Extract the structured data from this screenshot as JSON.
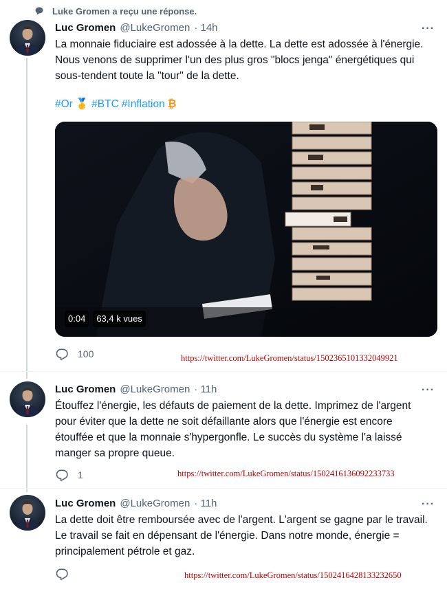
{
  "context": {
    "label": "Luke Gromen a reçu une réponse."
  },
  "tweets": [
    {
      "name": "Luc Gromen",
      "handle": "@LukeGromen",
      "time": "· 14h",
      "text": "La monnaie fiduciaire est adossée à la dette. La dette est adossée à l'énergie. Nous venons de supprimer l'un des plus gros \"blocs jenga\" énergétiques qui sous-tendent toute la \"tour\" de la dette.",
      "hashtags": [
        "#Or",
        "🥇",
        "#BTC",
        "#Inflation",
        "₿"
      ],
      "video": {
        "time": "0:04",
        "views": "63,4 k vues"
      },
      "replies": "100",
      "url": "https://twitter.com/LukeGromen/status/1502365101332049921"
    },
    {
      "name": "Luc Gromen",
      "handle": "@LukeGromen",
      "time": "· 11h",
      "text": "Étouffez l'énergie, les défauts de paiement de la dette. Imprimez de l'argent pour éviter que la dette ne soit défaillante alors que l'énergie est encore étouffée et que la monnaie s'hypergonfle. Le succès du système l'a laissé manger sa propre queue.",
      "replies": "1",
      "url": "https://twitter.com/LukeGromen/status/1502416136092233733"
    },
    {
      "name": "Luc Gromen",
      "handle": "@LukeGromen",
      "time": "· 11h",
      "text": "La dette doit être remboursée avec de l'argent. L'argent se gagne par le travail. Le travail se fait en dépensant de l'énergie. Dans notre monde, énergie = principalement pétrole et gaz.",
      "replies": "",
      "url": "https://twitter.com/LukeGromen/status/1502416428133232650"
    }
  ],
  "more_label": "···",
  "colors": {
    "link": "#1d9bf0",
    "secondary": "#536471",
    "url_red": "#c00000"
  },
  "icons": {
    "context": "speech-bubble-icon",
    "reply": "reply-icon",
    "more": "more-icon",
    "gold": "gold-medal-icon",
    "bitcoin": "bitcoin-icon"
  }
}
